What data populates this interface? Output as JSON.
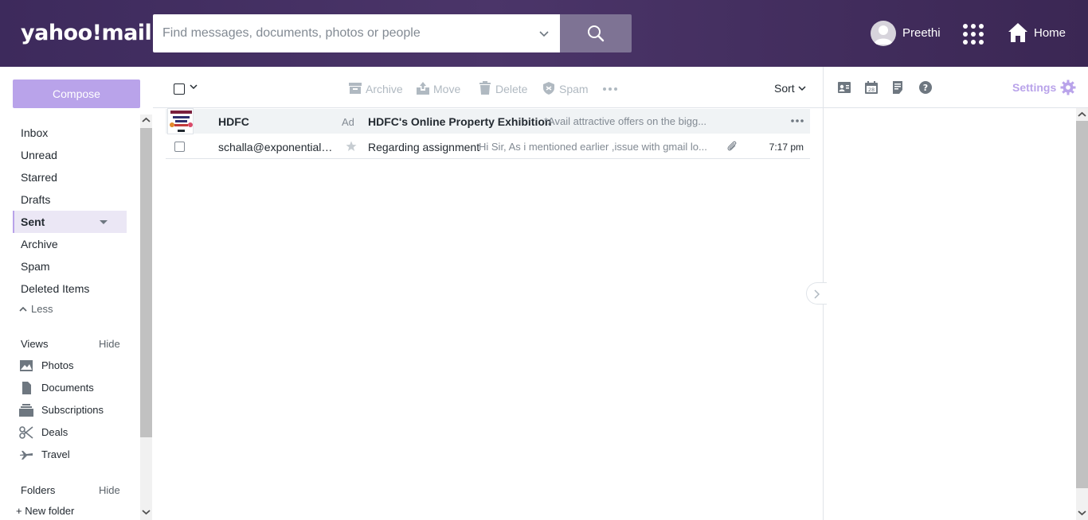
{
  "header": {
    "logo": "yahoo!mail",
    "search_placeholder": "Find messages, documents, photos or people",
    "user_name": "Preethi",
    "home_label": "Home"
  },
  "sidebar": {
    "compose_label": "Compose",
    "folders": [
      {
        "label": "Inbox",
        "icon": "inbox-icon"
      },
      {
        "label": "Unread"
      },
      {
        "label": "Starred"
      },
      {
        "label": "Drafts"
      },
      {
        "label": "Sent",
        "active": true
      },
      {
        "label": "Archive"
      },
      {
        "label": "Spam"
      },
      {
        "label": "Deleted Items"
      }
    ],
    "less_label": "Less",
    "views_title": "Views",
    "views_hide": "Hide",
    "views": [
      {
        "label": "Photos",
        "icon": "photos-icon"
      },
      {
        "label": "Documents",
        "icon": "documents-icon"
      },
      {
        "label": "Subscriptions",
        "icon": "subscriptions-icon"
      },
      {
        "label": "Deals",
        "icon": "deals-icon"
      },
      {
        "label": "Travel",
        "icon": "travel-icon"
      }
    ],
    "folders_title": "Folders",
    "folders_hide": "Hide",
    "new_folder": "New folder"
  },
  "toolbar": {
    "archive": "Archive",
    "move": "Move",
    "delete": "Delete",
    "spam": "Spam",
    "sort": "Sort"
  },
  "messages": {
    "ad": {
      "sender": "HDFC",
      "tag": "Ad",
      "subject": "HDFC's Online Property Exhibition",
      "snippet": "*Avail attractive offers on the bigg..."
    },
    "items": [
      {
        "sender": "schalla@exponentialai.c...",
        "subject": "Regarding assignment",
        "snippet": "Hi Sir, As i mentioned earlier ,issue with gmail lo...",
        "time": "7:17 pm",
        "has_attachment": true
      }
    ]
  },
  "right_panel": {
    "settings_label": "Settings",
    "icons": [
      "contacts-icon",
      "calendar-icon",
      "notepad-icon",
      "help-icon"
    ]
  },
  "colors": {
    "header_bg": "#3d2a5c",
    "accent": "#b9a3ea",
    "search_button": "#7e7394"
  }
}
